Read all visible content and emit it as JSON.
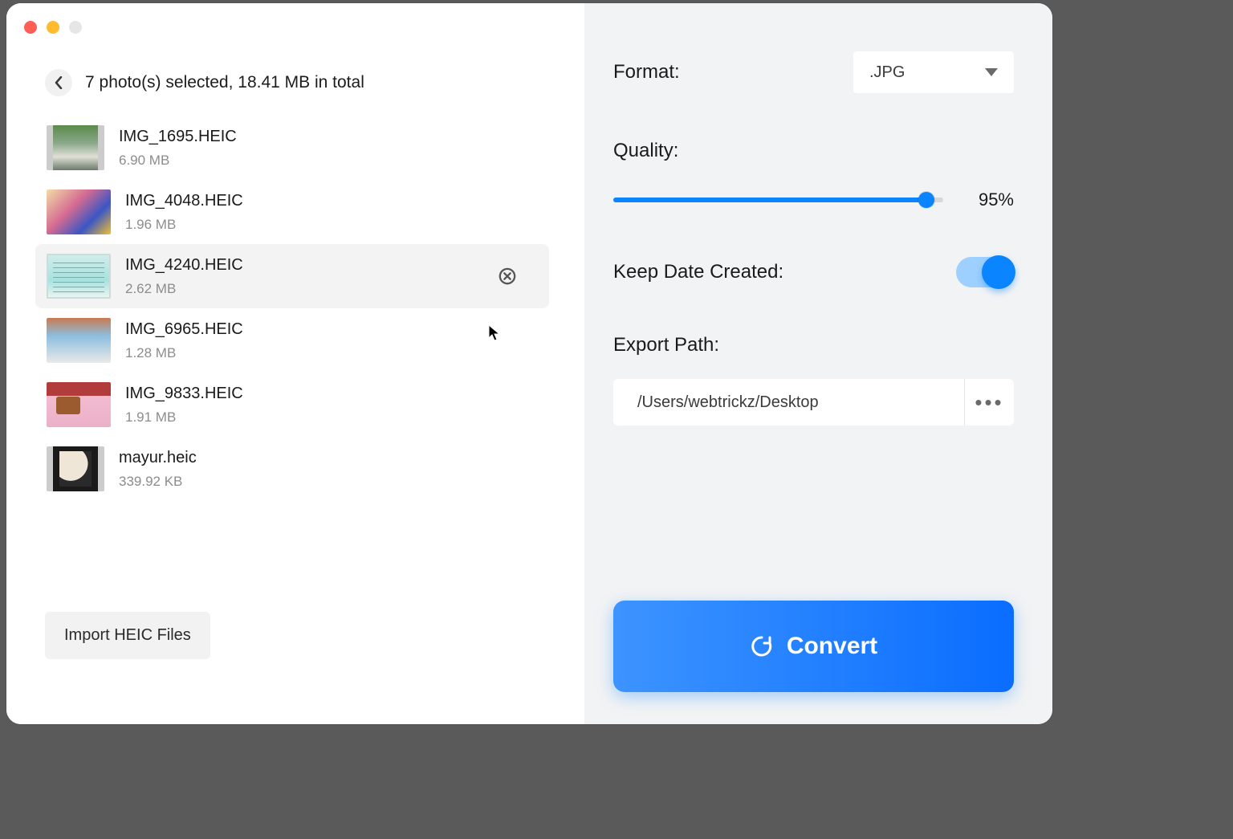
{
  "header": {
    "summary": "7 photo(s) selected, 18.41 MB in total"
  },
  "files": [
    {
      "name": "IMG_1695.HEIC",
      "size": "6.90 MB"
    },
    {
      "name": "IMG_4048.HEIC",
      "size": "1.96 MB"
    },
    {
      "name": "IMG_4240.HEIC",
      "size": "2.62 MB"
    },
    {
      "name": "IMG_6965.HEIC",
      "size": "1.28 MB"
    },
    {
      "name": "IMG_9833.HEIC",
      "size": "1.91 MB"
    },
    {
      "name": "mayur.heic",
      "size": "339.92 KB"
    }
  ],
  "import_button": "Import HEIC Files",
  "options": {
    "format_label": "Format:",
    "format_value": ".JPG",
    "quality_label": "Quality:",
    "quality_percent": 95,
    "quality_display": "95%",
    "keep_date_label": "Keep Date Created:",
    "keep_date_on": true,
    "export_label": "Export Path:",
    "export_path": "/Users/webtrickz/Desktop"
  },
  "convert_label": "Convert"
}
